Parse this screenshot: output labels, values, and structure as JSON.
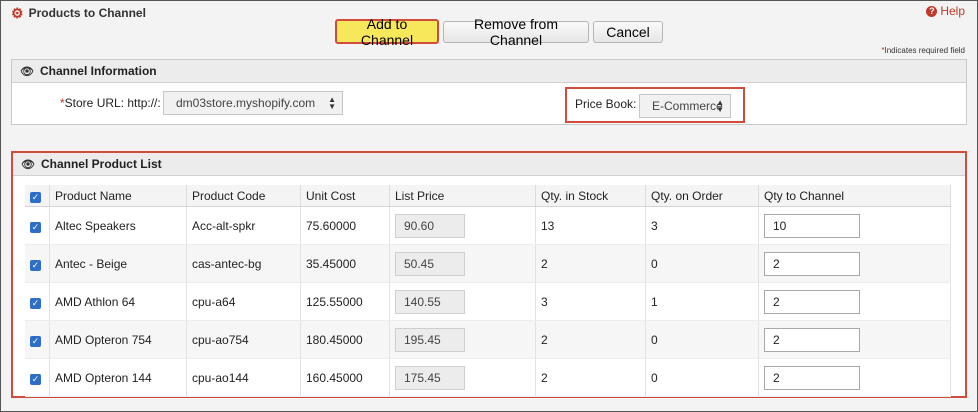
{
  "header": {
    "title": "Products to Channel",
    "help_label": "Help",
    "buttons": {
      "add": "Add to Channel",
      "remove": "Remove from Channel",
      "cancel": "Cancel"
    },
    "required_note": "Indicates required field"
  },
  "channel_info": {
    "heading": "Channel Information",
    "store_url_label": "Store URL: http://:",
    "store_url_value": "dm03store.myshopify.com",
    "price_book_label": "Price Book:",
    "price_book_value": "E-Commerce"
  },
  "product_list": {
    "heading": "Channel Product List",
    "columns": [
      "Product Name",
      "Product Code",
      "Unit Cost",
      "List Price",
      "Qty. in Stock",
      "Qty. on Order",
      "Qty to Channel"
    ],
    "rows": [
      {
        "name": "Altec Speakers",
        "code": "Acc-alt-spkr",
        "unit_cost": "75.60000",
        "list_price": "90.60",
        "stock": "13",
        "on_order": "3",
        "qty": "10"
      },
      {
        "name": "Antec - Beige",
        "code": "cas-antec-bg",
        "unit_cost": "35.45000",
        "list_price": "50.45",
        "stock": "2",
        "on_order": "0",
        "qty": "2"
      },
      {
        "name": "AMD Athlon 64",
        "code": "cpu-a64",
        "unit_cost": "125.55000",
        "list_price": "140.55",
        "stock": "3",
        "on_order": "1",
        "qty": "2"
      },
      {
        "name": "AMD Opteron 754",
        "code": "cpu-ao754",
        "unit_cost": "180.45000",
        "list_price": "195.45",
        "stock": "2",
        "on_order": "0",
        "qty": "2"
      },
      {
        "name": "AMD Opteron 144",
        "code": "cpu-ao144",
        "unit_cost": "160.45000",
        "list_price": "175.45",
        "stock": "2",
        "on_order": "0",
        "qty": "2"
      }
    ]
  },
  "icons": {
    "title": "gears-icon",
    "help": "question-circle-icon",
    "section": "eye-icon",
    "checkbox": "check-icon"
  },
  "colors": {
    "highlight_border": "#d24c3c",
    "add_button": "#f6e75b",
    "checkbox": "#2d6fc8"
  }
}
